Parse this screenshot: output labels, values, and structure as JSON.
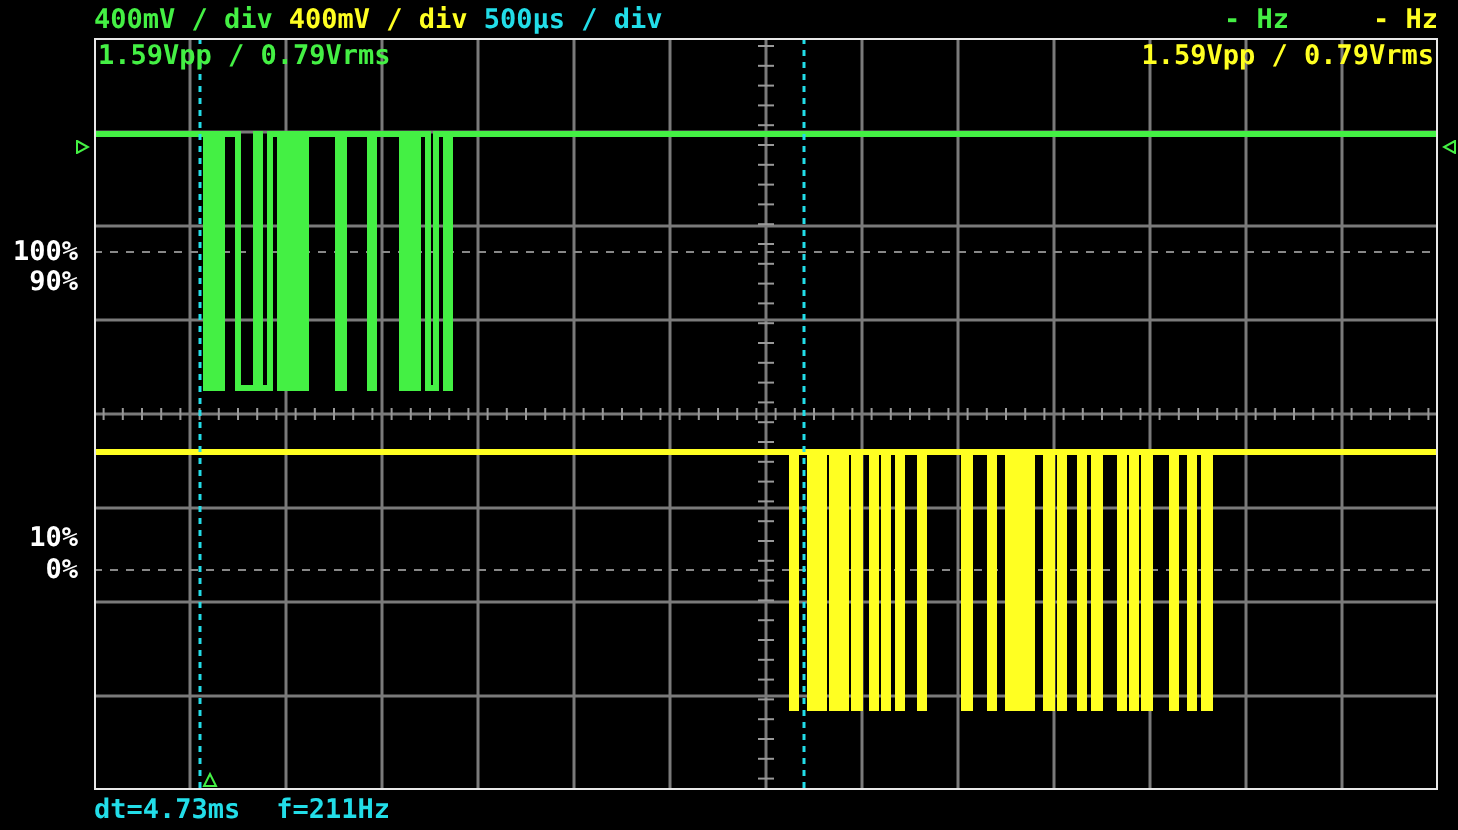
{
  "channels": [
    {
      "scale": "400mV / div",
      "frequency": "- Hz",
      "measurement": "1.59Vpp / 0.79Vrms",
      "color": "#44f044"
    },
    {
      "scale": "400mV / div",
      "frequency": "- Hz",
      "measurement": "1.59Vpp / 0.79Vrms",
      "color": "#ffff22"
    }
  ],
  "timebase": "500µs / div",
  "level_labels": [
    "100%",
    "90%",
    "10%",
    "0%"
  ],
  "cursor_readout": {
    "dt": "dt=4.73ms",
    "f": "f=211Hz"
  }
}
